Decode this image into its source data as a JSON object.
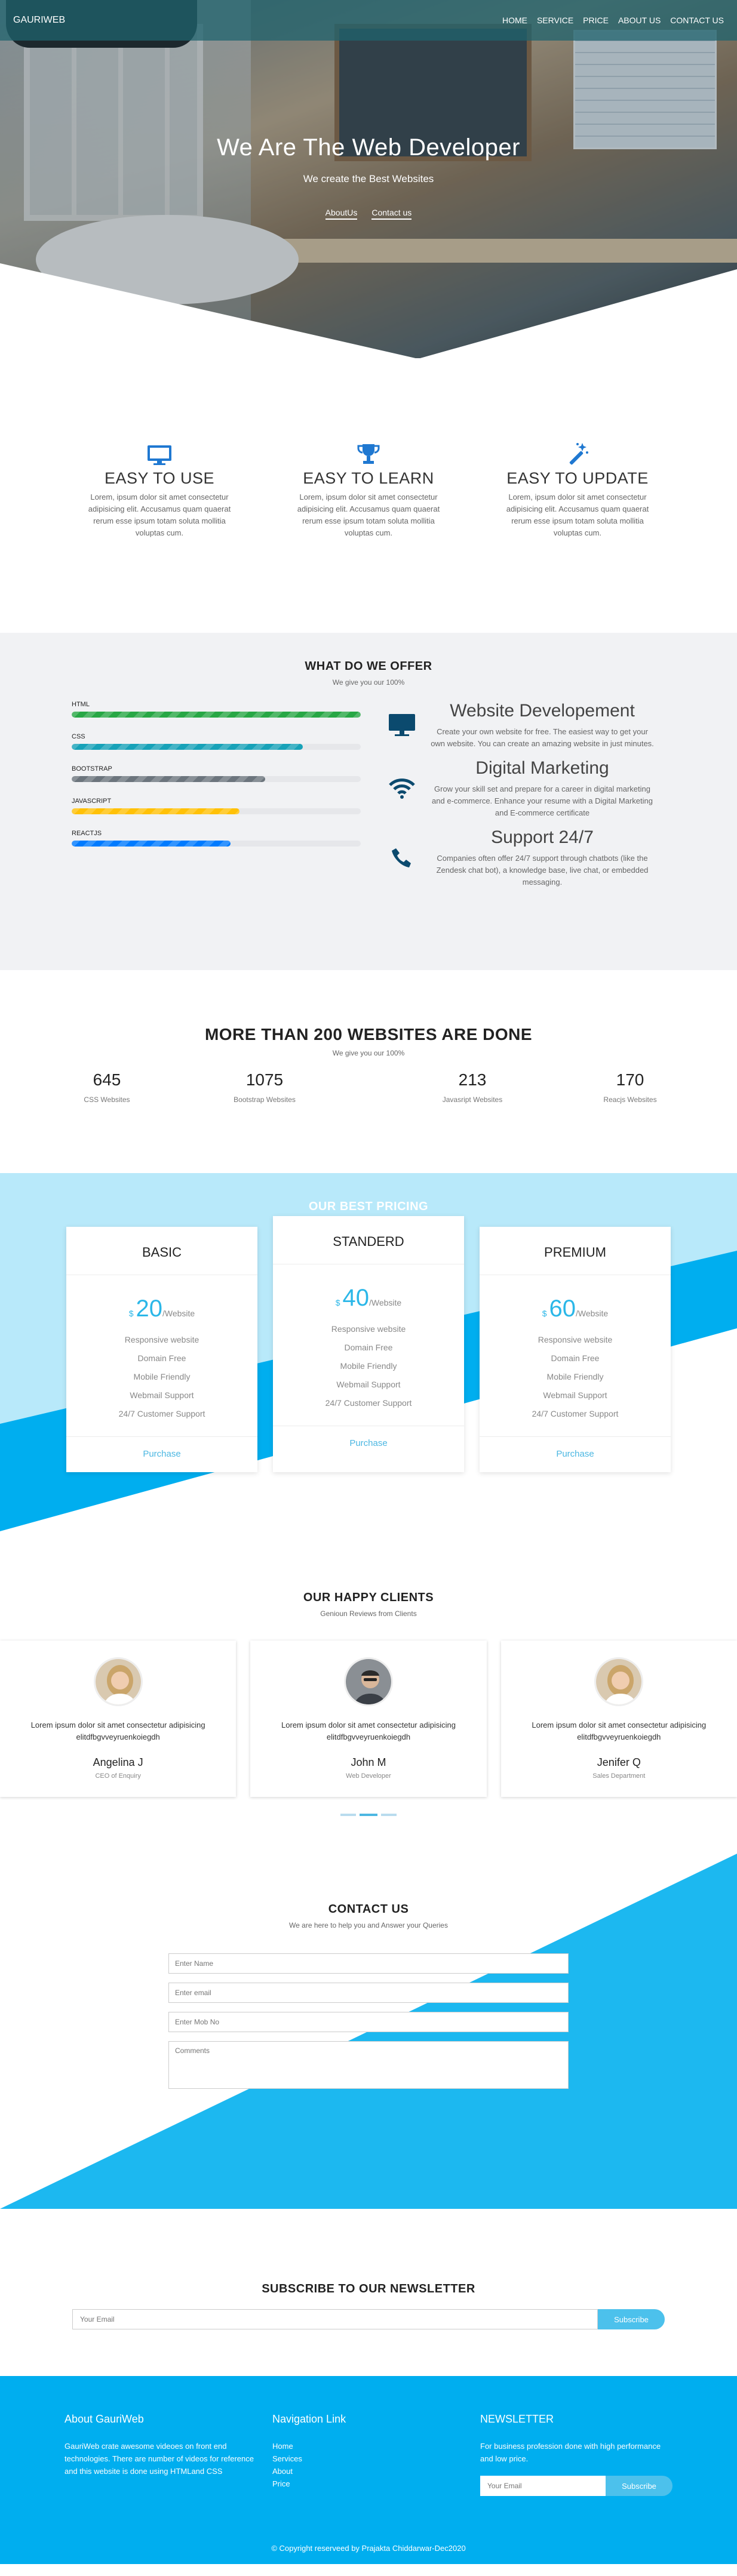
{
  "nav": {
    "brand": "GAURIWEB",
    "items": [
      "HOME",
      "SERVICE",
      "PRICE",
      "ABOUT US",
      "CONTACT US"
    ]
  },
  "hero": {
    "title": "We Are The Web Developer",
    "subtitle": "We create the Best Websites",
    "buttons": [
      "AboutUs",
      "Contact us"
    ]
  },
  "features": [
    {
      "icon": "monitor-icon",
      "title": "EASY TO USE",
      "text": "Lorem, ipsum dolor sit amet consectetur adipisicing elit. Accusamus quam quaerat rerum esse ipsum totam soluta mollitia voluptas cum."
    },
    {
      "icon": "trophy-icon",
      "title": "EASY TO LEARN",
      "text": "Lorem, ipsum dolor sit amet consectetur adipisicing elit. Accusamus quam quaerat rerum esse ipsum totam soluta mollitia voluptas cum."
    },
    {
      "icon": "magic-wand-icon",
      "title": "EASY TO UPDATE",
      "text": "Lorem, ipsum dolor sit amet consectetur adipisicing elit. Accusamus quam quaerat rerum esse ipsum totam soluta mollitia voluptas cum."
    }
  ],
  "offer": {
    "title": "WHAT DO WE OFFER",
    "subtitle": "We give you our 100%",
    "skills": [
      {
        "label": "HTML",
        "percent": 100,
        "color": "#28a745"
      },
      {
        "label": "CSS",
        "percent": 80,
        "color": "#17a2b8"
      },
      {
        "label": "BOOTSTRAP",
        "percent": 67,
        "color": "#6c757d"
      },
      {
        "label": "JAVASCRIPT",
        "percent": 58,
        "color": "#ffc107"
      },
      {
        "label": "REACTJS",
        "percent": 55,
        "color": "#007bff"
      }
    ],
    "services": [
      {
        "icon": "desktop-icon",
        "title": "Website Developement",
        "text": "Create your own website for free. The easiest way to get your own website. You can create an amazing website in just minutes."
      },
      {
        "icon": "wifi-icon",
        "title": "Digital Marketing",
        "text": "Grow your skill set and prepare for a career in digital marketing and e-commerce. Enhance your resume with a Digital Marketing and E-commerce certificate"
      },
      {
        "icon": "phone-icon",
        "title": "Support 24/7",
        "text": "Companies often offer 24/7 support through chatbots (like the Zendesk chat bot), a knowledge base, live chat, or embedded messaging."
      }
    ]
  },
  "stats": {
    "title": "MORE THAN 200 WEBSITES ARE DONE",
    "subtitle": "We give you our 100%",
    "items": [
      {
        "num": "645",
        "label": "CSS Websites"
      },
      {
        "num": "1075",
        "label": "Bootstrap Websites"
      },
      {
        "num": "213",
        "label": "Javasript Websites"
      },
      {
        "num": "170",
        "label": "Reacjs Websites"
      }
    ]
  },
  "pricing": {
    "title": "OUR BEST PRICING",
    "plans": [
      {
        "name": "BASIC",
        "currency": "$",
        "amount": "20",
        "per": "/Website",
        "features": [
          "Responsive website",
          "Domain Free",
          "Mobile Friendly",
          "Webmail Support",
          "24/7 Customer Support"
        ],
        "cta": "Purchase"
      },
      {
        "name": "STANDERD",
        "currency": "$",
        "amount": "40",
        "per": "/Website",
        "features": [
          "Responsive website",
          "Domain Free",
          "Mobile Friendly",
          "Webmail Support",
          "24/7 Customer Support"
        ],
        "cta": "Purchase"
      },
      {
        "name": "PREMIUM",
        "currency": "$",
        "amount": "60",
        "per": "/Website",
        "features": [
          "Responsive website",
          "Domain Free",
          "Mobile Friendly",
          "Webmail Support",
          "24/7 Customer Support"
        ],
        "cta": "Purchase"
      }
    ]
  },
  "clients": {
    "title": "OUR HAPPY CLIENTS",
    "subtitle": "Genioun Reviews from Clients",
    "items": [
      {
        "text": "Lorem ipsum dolor sit amet consectetur adipisicing elitdfbgvveyruenkoiegdh",
        "name": "Angelina J",
        "role": "CEO of Enquiry"
      },
      {
        "text": "Lorem ipsum dolor sit amet consectetur adipisicing elitdfbgvveyruenkoiegdh",
        "name": "John M",
        "role": "Web Developer"
      },
      {
        "text": "Lorem ipsum dolor sit amet consectetur adipisicing elitdfbgvveyruenkoiegdh",
        "name": "Jenifer Q",
        "role": "Sales Department"
      }
    ]
  },
  "contact": {
    "title": "CONTACT US",
    "subtitle": "We are here to help you and Answer your Queries",
    "name_placeholder": "Enter Name",
    "email_placeholder": "Enter email",
    "mobile_placeholder": "Enter Mob No",
    "comments_placeholder": "Comments"
  },
  "newsletter": {
    "title": "SUBSCRIBE TO OUR NEWSLETTER",
    "email_placeholder": "Your Email",
    "button": "Subscribe"
  },
  "footer": {
    "about_title": "About GauriWeb",
    "about_text": "GauriWeb crate awesome videoes on front end technologies. There are number of videos for reference and this website is done using HTMLand CSS",
    "nav_title": "Navigation Link",
    "nav_links": [
      "Home",
      "Services",
      "About",
      "Price"
    ],
    "news_title": "NEWSLETTER",
    "news_text": "For business profession done with high performance and low price.",
    "email_placeholder": "Your Email",
    "button": "Subscribe",
    "copyright": "© Copyright reserveed by Prajakta Chiddarwar-Dec2020"
  },
  "colors": {
    "accent": "#00aeef",
    "light_accent": "#b8e9fa",
    "button": "#4cc1ec"
  }
}
